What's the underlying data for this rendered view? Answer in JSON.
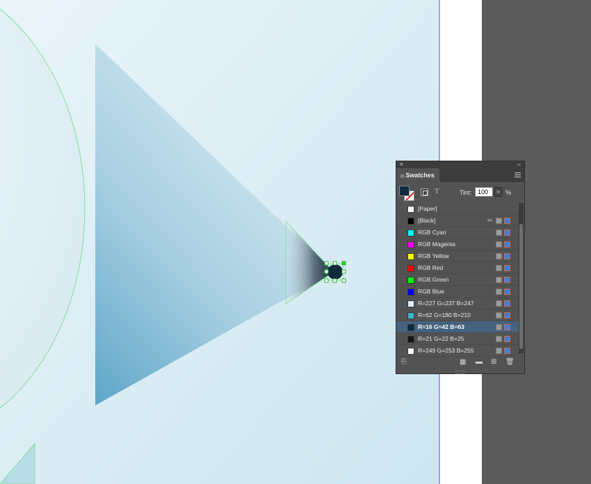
{
  "panel": {
    "close_icon": "✕",
    "collapse_icon": "‹‹",
    "tab_chevron": "◇",
    "title": "Swatches",
    "tint_label": "Tint:",
    "tint_value": "100",
    "tint_arrow": ">",
    "tint_unit": "%",
    "text_icon": "T",
    "fill_color": "#102a3f",
    "swatches": [
      {
        "name": "[Paper]",
        "color": "#ffffff",
        "selected": false
      },
      {
        "name": "[Black]",
        "color": "#000000",
        "selected": false
      },
      {
        "name": "RGB Cyan",
        "color": "#00ffff",
        "selected": false
      },
      {
        "name": "RGB Magenta",
        "color": "#ff00ff",
        "selected": false
      },
      {
        "name": "RGB Yellow",
        "color": "#ffff00",
        "selected": false
      },
      {
        "name": "RGB Red",
        "color": "#ff0000",
        "selected": false
      },
      {
        "name": "RGB Green",
        "color": "#00ff00",
        "selected": false
      },
      {
        "name": "RGB Blue",
        "color": "#0000ff",
        "selected": false
      },
      {
        "name": "R=227 G=237 B=247",
        "color": "#e3edf7",
        "selected": false
      },
      {
        "name": "R=62 G=180 B=210",
        "color": "#3eb4d2",
        "selected": false
      },
      {
        "name": "R=16 G=42 B=63",
        "color": "#102a3f",
        "selected": true
      },
      {
        "name": "R=21 G=22 B=25",
        "color": "#151619",
        "selected": false
      },
      {
        "name": "R=249 G=253 B=255",
        "color": "#f9fdff",
        "selected": false
      }
    ]
  },
  "colors": {
    "canvas_bg": "#d8ecf4",
    "pasteboard": "#5b5b5b",
    "panel_bg": "#535353",
    "selected_row": "#45627e"
  }
}
